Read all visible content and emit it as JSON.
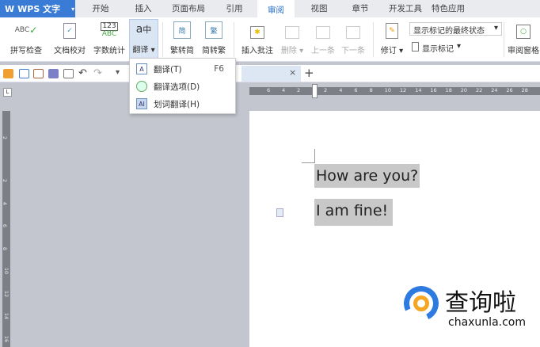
{
  "app": {
    "title": "WPS 文字"
  },
  "tabs": [
    "开始",
    "插入",
    "页面布局",
    "引用",
    "审阅",
    "视图",
    "章节",
    "开发工具",
    "特色应用"
  ],
  "ribbon": {
    "spell_check": "拼写检查",
    "doc_proof": "文档校对",
    "word_count": "字数统计",
    "translate": "翻译",
    "trad_to_simp": "繁转简",
    "simp_to_trad": "简转繁",
    "insert_comment": "插入批注",
    "delete": "删除",
    "prev": "上一条",
    "next": "下一条",
    "track": "修订",
    "markup_state": "显示标记的最终状态",
    "show_markup": "显示标记",
    "review_pane": "审阅窗格",
    "icon_abc": "ABC",
    "icon_123": "123",
    "icon_jian": "简",
    "icon_fan": "繁"
  },
  "translate_menu": [
    {
      "label": "翻译(T)",
      "shortcut": "F6"
    },
    {
      "label": "翻译选项(D)"
    },
    {
      "label": "划词翻译(H)"
    }
  ],
  "doctab": {
    "close": "×",
    "new": "+"
  },
  "hruler": [
    "6",
    "4",
    "2",
    "2",
    "4",
    "6",
    "8",
    "10",
    "12",
    "14",
    "16",
    "18",
    "20",
    "22",
    "24",
    "26",
    "28"
  ],
  "vruler": [
    "2",
    "2",
    "4",
    "6",
    "8",
    "10",
    "12",
    "14",
    "16"
  ],
  "document": {
    "line1": "How are you?",
    "line2": "I am fine!"
  },
  "watermark": {
    "name": "查询啦",
    "url": "chaxunla.com"
  },
  "colors": {
    "accent": "#3a7bd5",
    "highlight": "#c8c8c8"
  }
}
